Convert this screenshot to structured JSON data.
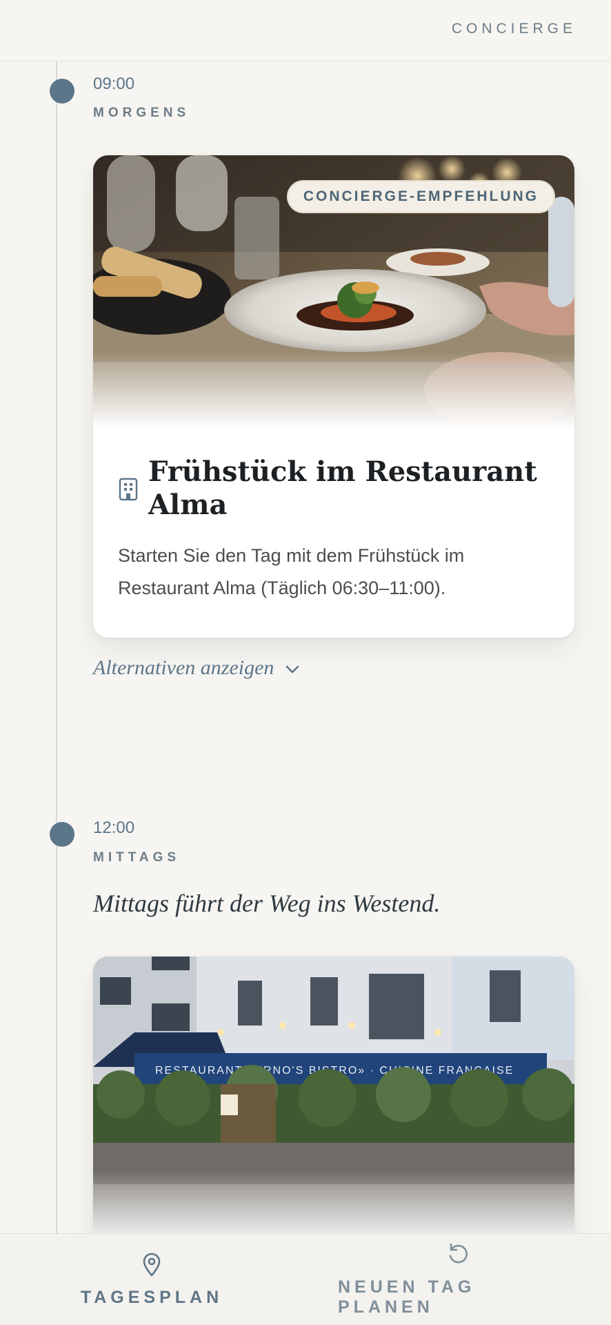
{
  "header": {
    "brand": "CONCIERGE"
  },
  "timeline": {
    "slots": [
      {
        "time": "09:00",
        "period": "MORGENS",
        "card": {
          "badge": "CONCIERGE-EMPFEHLUNG",
          "title": "Frühstück im Restaurant Alma",
          "description": "Starten Sie den Tag mit dem Frühstück im Restaurant Alma (Täglich 06:30–11:00).",
          "icon": "building-icon"
        },
        "alternatives_label": "Alternativen anzeigen"
      },
      {
        "time": "12:00",
        "period": "MITTAGS",
        "lead": "Mittags führt der Weg ins Westend.",
        "card": {
          "sign_text": "RESTAURANT «ERNO'S BISTRO» · CUISINE FRANÇAISE"
        }
      }
    ]
  },
  "bottom_nav": {
    "items": [
      {
        "label": "TAGESPLAN",
        "icon": "map-pin-icon"
      },
      {
        "label": "NEUEN TAG PLANEN",
        "icon": "refresh-icon"
      }
    ]
  },
  "colors": {
    "accent": "#5b7589",
    "background": "#f6f5f1"
  }
}
